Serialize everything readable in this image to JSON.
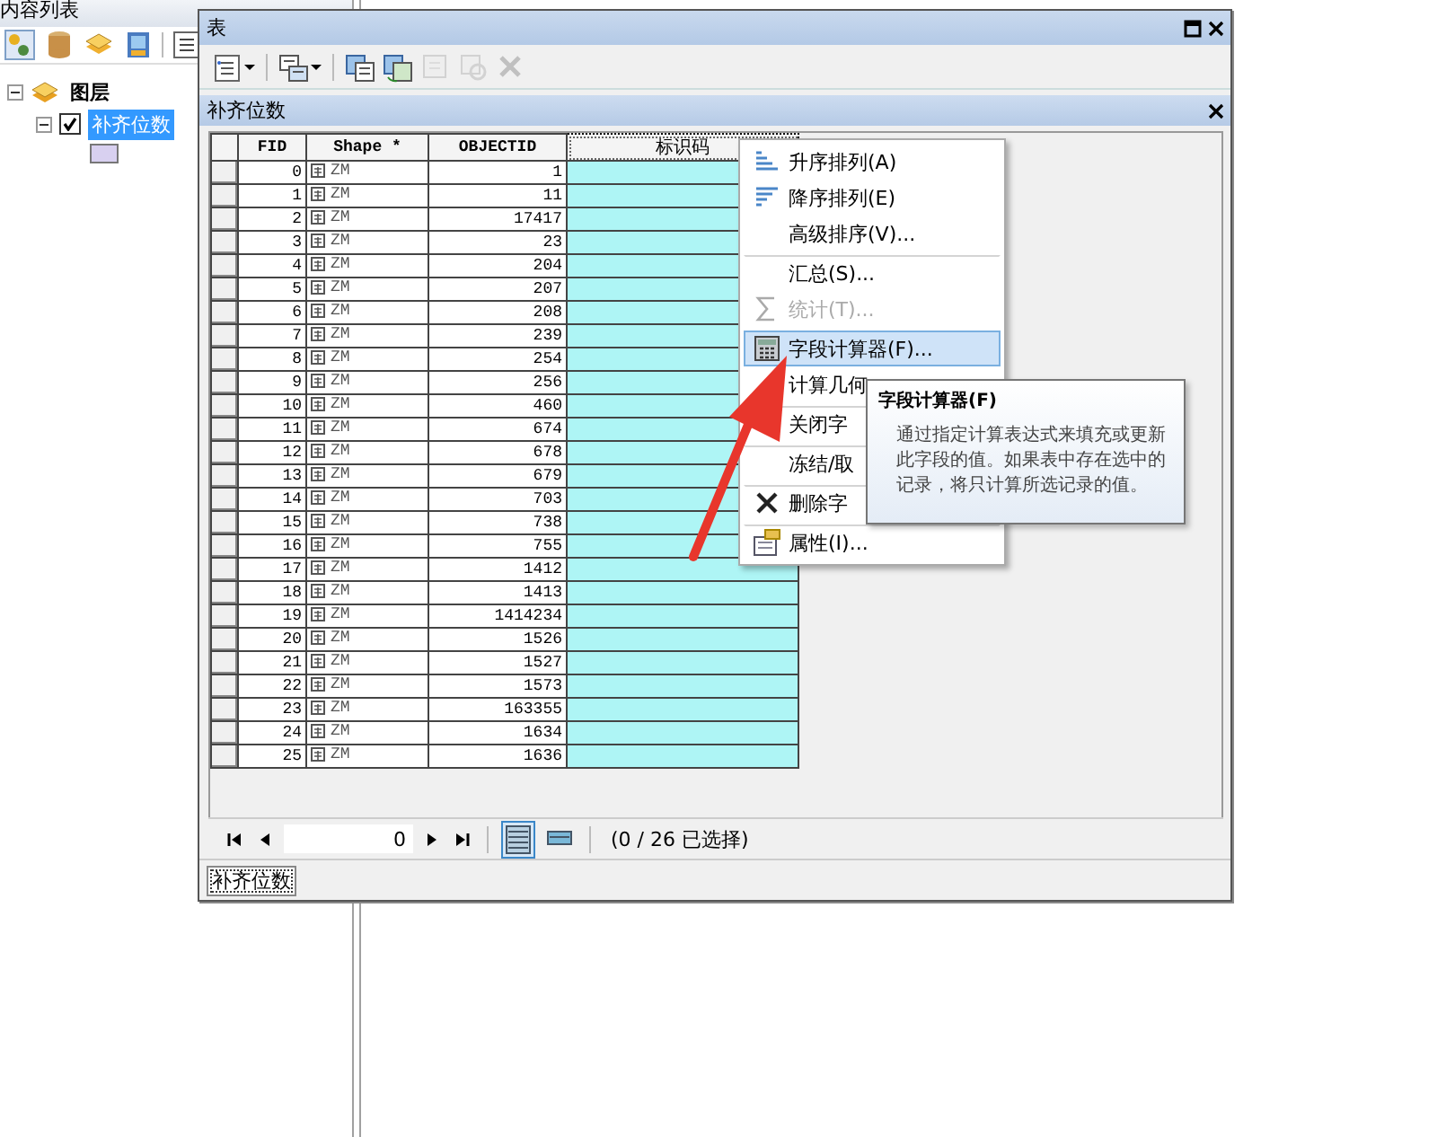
{
  "contents_pane": {
    "title": "内容列表",
    "group": {
      "label": "图层",
      "expanded": true,
      "children": [
        {
          "label": "补齐位数",
          "checked": true,
          "selected": true,
          "expanded": true
        }
      ]
    }
  },
  "table_window": {
    "title": "表",
    "toolbar": [
      {
        "kind": "options",
        "dropdown": true,
        "disabled": false
      },
      {
        "kind": "related",
        "dropdown": true,
        "disabled": false
      },
      {
        "kind": "select",
        "dropdown": false,
        "disabled": false
      },
      {
        "kind": "switch",
        "dropdown": false,
        "disabled": false
      },
      {
        "kind": "clear",
        "dropdown": false,
        "disabled": true
      },
      {
        "kind": "zoom",
        "dropdown": false,
        "disabled": true
      },
      {
        "kind": "delete",
        "dropdown": false,
        "disabled": true
      }
    ],
    "table_title": "补齐位数",
    "columns": [
      {
        "label": "FID",
        "selected": false
      },
      {
        "label": "Shape *",
        "selected": false
      },
      {
        "label": "OBJECTID",
        "selected": false
      },
      {
        "label": "标识码",
        "selected": true
      }
    ],
    "rows": [
      {
        "fid": "0",
        "shape": "ZM",
        "objectid": "1"
      },
      {
        "fid": "1",
        "shape": "ZM",
        "objectid": "11"
      },
      {
        "fid": "2",
        "shape": "ZM",
        "objectid": "17417"
      },
      {
        "fid": "3",
        "shape": "ZM",
        "objectid": "23"
      },
      {
        "fid": "4",
        "shape": "ZM",
        "objectid": "204"
      },
      {
        "fid": "5",
        "shape": "ZM",
        "objectid": "207"
      },
      {
        "fid": "6",
        "shape": "ZM",
        "objectid": "208"
      },
      {
        "fid": "7",
        "shape": "ZM",
        "objectid": "239"
      },
      {
        "fid": "8",
        "shape": "ZM",
        "objectid": "254"
      },
      {
        "fid": "9",
        "shape": "ZM",
        "objectid": "256"
      },
      {
        "fid": "10",
        "shape": "ZM",
        "objectid": "460"
      },
      {
        "fid": "11",
        "shape": "ZM",
        "objectid": "674"
      },
      {
        "fid": "12",
        "shape": "ZM",
        "objectid": "678"
      },
      {
        "fid": "13",
        "shape": "ZM",
        "objectid": "679"
      },
      {
        "fid": "14",
        "shape": "ZM",
        "objectid": "703"
      },
      {
        "fid": "15",
        "shape": "ZM",
        "objectid": "738"
      },
      {
        "fid": "16",
        "shape": "ZM",
        "objectid": "755"
      },
      {
        "fid": "17",
        "shape": "ZM",
        "objectid": "1412"
      },
      {
        "fid": "18",
        "shape": "ZM",
        "objectid": "1413"
      },
      {
        "fid": "19",
        "shape": "ZM",
        "objectid": "1414234"
      },
      {
        "fid": "20",
        "shape": "ZM",
        "objectid": "1526"
      },
      {
        "fid": "21",
        "shape": "ZM",
        "objectid": "1527"
      },
      {
        "fid": "22",
        "shape": "ZM",
        "objectid": "1573"
      },
      {
        "fid": "23",
        "shape": "ZM",
        "objectid": "163355"
      },
      {
        "fid": "24",
        "shape": "ZM",
        "objectid": "1634"
      },
      {
        "fid": "25",
        "shape": "ZM",
        "objectid": "1636"
      }
    ],
    "navigator": {
      "record": "0",
      "status": "(0 / 26 已选择)",
      "views": [
        {
          "kind": "all",
          "selected": true
        },
        {
          "kind": "selected",
          "selected": false
        }
      ]
    },
    "tabs": [
      {
        "label": "补齐位数",
        "selected": true
      }
    ]
  },
  "context_menu": {
    "items": [
      {
        "label": "升序排列(A)",
        "kind": "ascending",
        "disabled": false,
        "highlighted": false,
        "separator_before": false
      },
      {
        "label": "降序排列(E)",
        "kind": "descending",
        "disabled": false,
        "highlighted": false,
        "separator_before": false
      },
      {
        "label": "高级排序(V)...",
        "kind": "plain",
        "disabled": false,
        "highlighted": false,
        "separator_before": false
      },
      {
        "label": "汇总(S)...",
        "kind": "plain",
        "disabled": false,
        "highlighted": false,
        "separator_before": true
      },
      {
        "label": "统计(T)...",
        "kind": "statistics",
        "disabled": true,
        "highlighted": false,
        "separator_before": false
      },
      {
        "label": "字段计算器(F)...",
        "kind": "calculator",
        "disabled": false,
        "highlighted": true,
        "separator_before": true
      },
      {
        "label": "计算几何",
        "kind": "plain",
        "disabled": false,
        "highlighted": false,
        "separator_before": false
      },
      {
        "label": "关闭字",
        "kind": "plain",
        "disabled": false,
        "highlighted": false,
        "separator_before": true
      },
      {
        "label": "冻结/取",
        "kind": "plain",
        "disabled": false,
        "highlighted": false,
        "separator_before": true
      },
      {
        "label": "删除字",
        "kind": "delete",
        "disabled": false,
        "highlighted": false,
        "separator_before": true
      },
      {
        "label": "属性(I)...",
        "kind": "properties",
        "disabled": false,
        "highlighted": false,
        "separator_before": true
      }
    ]
  },
  "tooltip": {
    "title": "字段计算器(F)",
    "text": "通过指定计算表达式来填充或更新此字段的值。如果表中存在选中的记录，将只计算所选记录的值。"
  },
  "annotation": {
    "kind": "arrow"
  }
}
